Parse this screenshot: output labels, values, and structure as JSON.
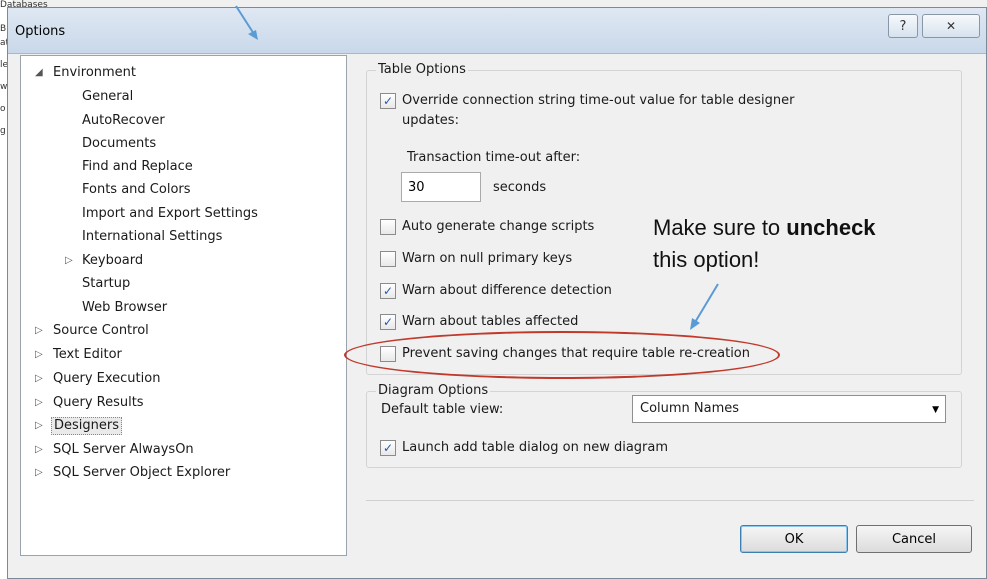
{
  "background": {
    "databases_label": "Databases",
    "fragments": [
      "B",
      "at",
      "le",
      "w",
      "o",
      "g"
    ]
  },
  "dialog": {
    "title": "Options",
    "help_glyph": "?",
    "close_glyph": "✕"
  },
  "tree": {
    "items": [
      {
        "label": "Environment",
        "expander": "◢",
        "level": 0
      },
      {
        "label": "General",
        "level": 1
      },
      {
        "label": "AutoRecover",
        "level": 1
      },
      {
        "label": "Documents",
        "level": 1
      },
      {
        "label": "Find and Replace",
        "level": 1
      },
      {
        "label": "Fonts and Colors",
        "level": 1
      },
      {
        "label": "Import and Export Settings",
        "level": 1
      },
      {
        "label": "International Settings",
        "level": 1
      },
      {
        "label": "Keyboard",
        "expander": "▷",
        "level": 1
      },
      {
        "label": "Startup",
        "level": 1
      },
      {
        "label": "Web Browser",
        "level": 1
      },
      {
        "label": "Source Control",
        "expander": "▷",
        "level": 0
      },
      {
        "label": "Text Editor",
        "expander": "▷",
        "level": 0
      },
      {
        "label": "Query Execution",
        "expander": "▷",
        "level": 0
      },
      {
        "label": "Query Results",
        "expander": "▷",
        "level": 0
      },
      {
        "label": "Designers",
        "expander": "▷",
        "level": 0,
        "selected": true
      },
      {
        "label": "SQL Server AlwaysOn",
        "expander": "▷",
        "level": 0
      },
      {
        "label": "SQL Server Object Explorer",
        "expander": "▷",
        "level": 0
      }
    ]
  },
  "table_options": {
    "legend": "Table Options",
    "override": {
      "line1": "Override connection string time-out value for table designer",
      "line2": "updates:",
      "checked": true
    },
    "transaction_label": "Transaction time-out after:",
    "timeout_value": "30",
    "seconds_label": "seconds",
    "auto_generate": {
      "label": "Auto generate change scripts",
      "checked": false
    },
    "warn_null": {
      "label": "Warn on null primary keys",
      "checked": false
    },
    "warn_difference": {
      "label": "Warn about difference detection",
      "checked": true
    },
    "warn_tables": {
      "label": "Warn about tables affected",
      "checked": true
    },
    "prevent_saving": {
      "label": "Prevent saving changes that require table re-creation",
      "checked": false
    }
  },
  "diagram_options": {
    "legend": "Diagram Options",
    "default_view_label": "Default table view:",
    "default_view_value": "Column Names",
    "launch_add_table": {
      "label": "Launch add table dialog on new diagram",
      "checked": true
    }
  },
  "buttons": {
    "ok": "OK",
    "cancel": "Cancel"
  },
  "annotation": {
    "line1_prefix": "Make sure to ",
    "line1_bold": "uncheck",
    "line2": "this option!",
    "color": "#c0392b",
    "arrow_color": "#5b9bd5"
  },
  "check_glyph": "✓"
}
